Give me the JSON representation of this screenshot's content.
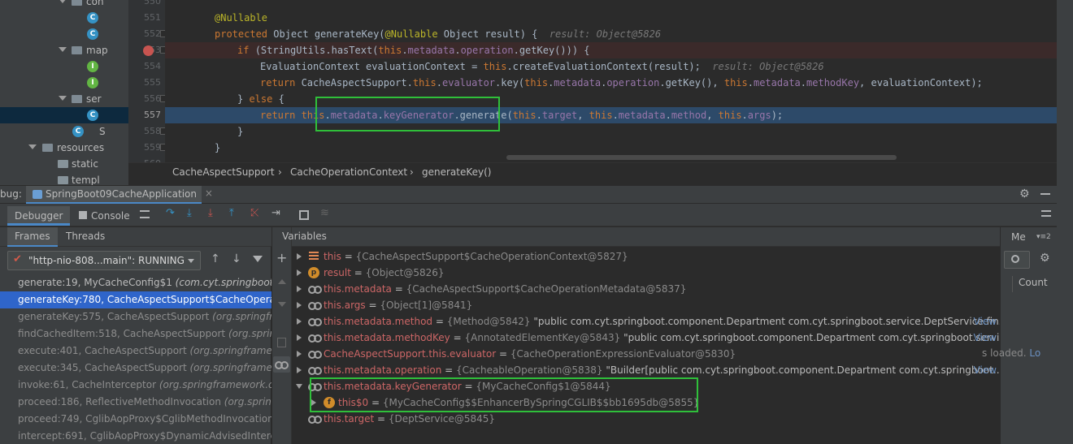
{
  "project_tree": {
    "rows": [
      {
        "label": "con",
        "kind": "folder"
      },
      {
        "label": "",
        "kind": "class"
      },
      {
        "label": "",
        "kind": "class"
      },
      {
        "label": "map",
        "kind": "folder"
      },
      {
        "label": "",
        "kind": "interface"
      },
      {
        "label": "",
        "kind": "interface"
      },
      {
        "label": "ser",
        "kind": "folder"
      },
      {
        "label": "",
        "kind": "class"
      },
      {
        "label": "S",
        "kind": "class"
      },
      {
        "label": "resources",
        "kind": "folder"
      },
      {
        "label": "static",
        "kind": "folder"
      },
      {
        "label": "templ",
        "kind": "folder"
      }
    ]
  },
  "gutter": {
    "line_numbers": [
      "550",
      "551",
      "552",
      "553",
      "554",
      "555",
      "556",
      "557",
      "558",
      "559",
      "560"
    ]
  },
  "code": {
    "l551_ann": "@Nullable",
    "l552_kw": "protected ",
    "l552_a": "Object generateKey(",
    "l552_ann": "@Nullable ",
    "l552_b": "Object result) {",
    "l552_hint": "result: Object@5826",
    "l553_kw": "if ",
    "l553_a": "(StringUtils.hasText(",
    "l553_this": "this",
    "l553_dot": ".",
    "l553_f1": "metadata",
    "l553_dot2": ".",
    "l553_f2": "operation",
    "l553_b": ".getKey())) {",
    "l554_a": "EvaluationContext evaluationContext = ",
    "l554_this": "this",
    "l554_b": ".createEvaluationContext(result);",
    "l554_hint": "result: Object@5826",
    "l555_kw": "return ",
    "l555_a": "CacheAspectSupport.",
    "l555_this": "this",
    "l555_dot": ".",
    "l555_f1": "evaluator",
    "l555_b": ".key(",
    "l555_this2": "this",
    "l555_dot2": ".",
    "l555_f2": "metadata",
    "l555_dot3": ".",
    "l555_f3": "operation",
    "l555_c": ".getKey(), ",
    "l555_this3": "this",
    "l555_dot4": ".",
    "l555_f4": "metadata",
    "l555_dot5": ".",
    "l555_f5": "methodKey",
    "l555_d": ", evaluationContext);",
    "l556_a": "} ",
    "l556_kw": "else ",
    "l556_b": "{",
    "l557_kw": "return ",
    "l557_this": "this",
    "l557_dot": ".",
    "l557_f1": "metadata",
    "l557_dot2": ".",
    "l557_f2": "keyGenerator",
    "l557_a": ".generate(",
    "l557_this2": "this",
    "l557_dot3": ".",
    "l557_f3": "target",
    "l557_b": ", ",
    "l557_this3": "this",
    "l557_dot4": ".",
    "l557_f4": "metadata",
    "l557_dot5": ".",
    "l557_f5": "method",
    "l557_c": ", ",
    "l557_this4": "this",
    "l557_dot6": ".",
    "l557_f6": "args",
    "l557_d": ");",
    "l558": "}",
    "l559": "}"
  },
  "breadcrumb": [
    "CacheAspectSupport",
    "CacheOperationContext",
    "generateKey()"
  ],
  "debug": {
    "label": "bug:",
    "run_config": "SpringBoot09CacheApplication",
    "tabs": {
      "debugger": "Debugger",
      "console": "Console"
    },
    "frames_tab": "Frames",
    "threads_tab": "Threads",
    "variables_header": "Variables",
    "thread_selector": "\"http-nio-808...main\": RUNNING",
    "watches_header": "Me",
    "count_label": "Count",
    "loaded_text": "s loaded.",
    "loaded_link": "Lo"
  },
  "frames": [
    {
      "method": "generate:19, MyCacheConfig$1 ",
      "pkg": "(com.cyt.springboot.c",
      "state": "user"
    },
    {
      "method": "generateKey:780, CacheAspectSupport$CacheOperat",
      "pkg": "",
      "state": "selected"
    },
    {
      "method": "generateKey:575, CacheAspectSupport ",
      "pkg": "(org.springfra",
      "state": "lib"
    },
    {
      "method": "findCachedItem:518, CacheAspectSupport ",
      "pkg": "(org.spring",
      "state": "lib"
    },
    {
      "method": "execute:401, CacheAspectSupport ",
      "pkg": "(org.springframew",
      "state": "lib"
    },
    {
      "method": "execute:345, CacheAspectSupport ",
      "pkg": "(org.springframew",
      "state": "lib"
    },
    {
      "method": "invoke:61, CacheInterceptor ",
      "pkg": "(org.springframework.ca",
      "state": "lib"
    },
    {
      "method": "proceed:186, ReflectiveMethodInvocation ",
      "pkg": "(org.spring",
      "state": "lib"
    },
    {
      "method": "proceed:749, CglibAopProxy$CglibMethodInvocation",
      "pkg": "",
      "state": "lib"
    },
    {
      "method": "intercept:691, CglibAopProxy$DynamicAdvisedInterce",
      "pkg": "",
      "state": "lib"
    }
  ],
  "variables": [
    {
      "name": "this",
      "value": "{CacheAspectSupport$CacheOperationContext@5827}",
      "extra": "",
      "link": "",
      "icon": "list",
      "expand": "collapsed"
    },
    {
      "name": "result",
      "value": "{Object@5826}",
      "extra": "",
      "link": "",
      "icon": "param",
      "expand": "collapsed"
    },
    {
      "name": "this.metadata",
      "value": "{CacheAspectSupport$CacheOperationMetadata@5837}",
      "extra": "",
      "link": "",
      "icon": "glasses",
      "expand": "collapsed"
    },
    {
      "name": "this.args",
      "value": "{Object[1]@5841}",
      "extra": "",
      "link": "",
      "icon": "glasses",
      "expand": "collapsed"
    },
    {
      "name": "this.metadata.method",
      "value": "{Method@5842} ",
      "extra": "\"public com.cyt.springboot.component.Department com.cyt.springboot.service.DeptService.fin...",
      "link": "View",
      "icon": "glasses",
      "expand": "collapsed"
    },
    {
      "name": "this.metadata.methodKey",
      "value": "{AnnotatedElementKey@5843} ",
      "extra": "\"public com.cyt.springboot.component.Department com.cyt.springboot.servi...",
      "link": "View",
      "icon": "glasses",
      "expand": "collapsed"
    },
    {
      "name": "CacheAspectSupport.this.evaluator",
      "value": "{CacheOperationExpressionEvaluator@5830}",
      "extra": "",
      "link": "",
      "icon": "glasses",
      "expand": "collapsed"
    },
    {
      "name": "this.metadata.operation",
      "value": "{CacheableOperation@5838} ",
      "extra": "\"Builder[public com.cyt.springboot.component.Department com.cyt.springboot....",
      "link": "View",
      "icon": "glasses",
      "expand": "collapsed"
    },
    {
      "name": "this.metadata.keyGenerator",
      "value": "{MyCacheConfig$1@5844}",
      "extra": "",
      "link": "",
      "icon": "glasses",
      "expand": "expanded"
    },
    {
      "name": "this$0",
      "value": "{MyCacheConfig$$EnhancerBySpringCGLIB$$bb1695db@5855}",
      "extra": "",
      "link": "",
      "icon": "field",
      "expand": "child"
    },
    {
      "name": "this.target",
      "value": "{DeptService@5845}",
      "extra": "",
      "link": "",
      "icon": "glasses",
      "expand": "collapsed"
    }
  ],
  "colors": {
    "highlight_box": "#2fbf3a",
    "selected_frame": "#2f65ca",
    "exec_line": "#2d4a69"
  }
}
